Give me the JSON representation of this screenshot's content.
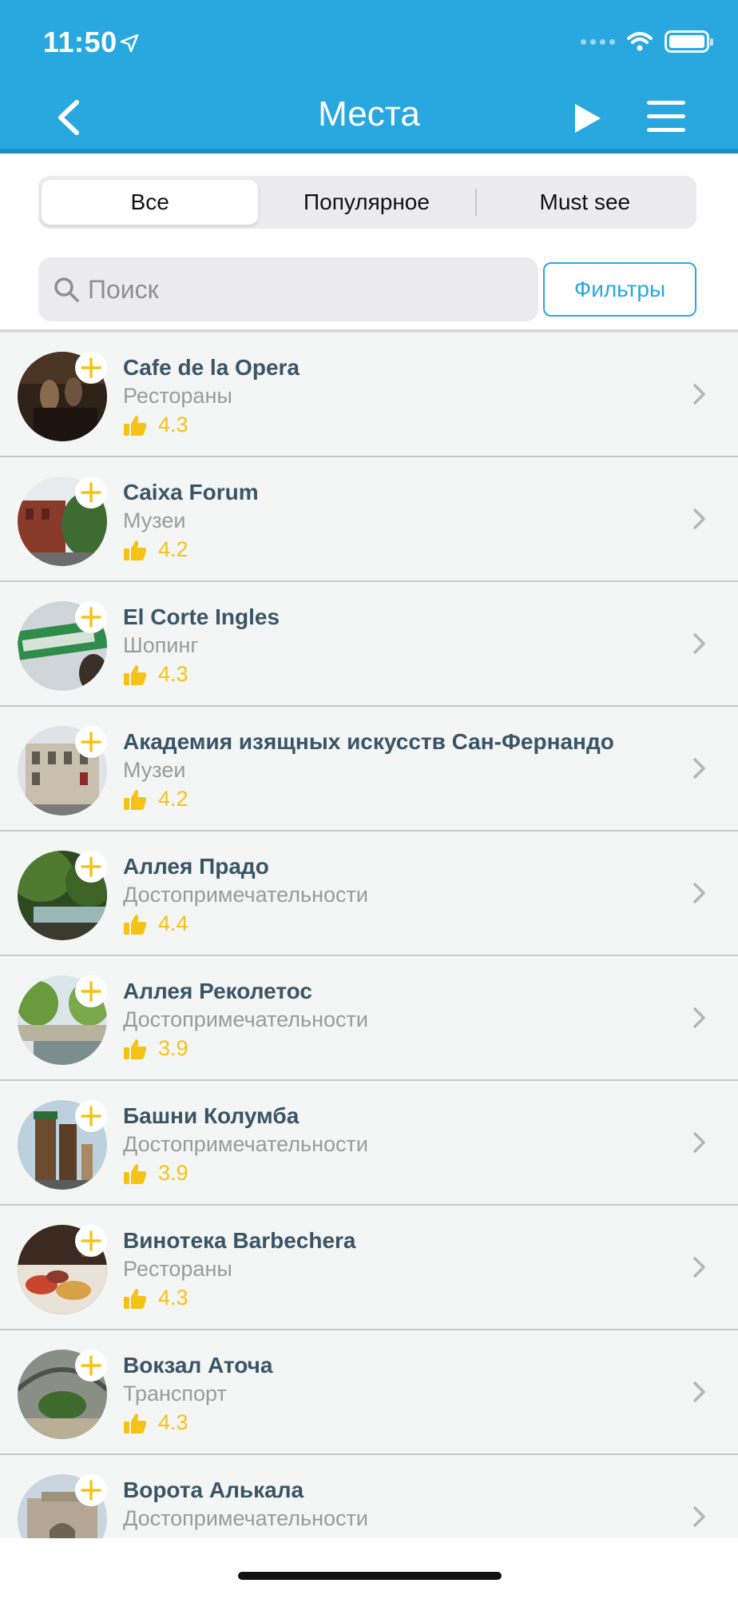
{
  "status_bar": {
    "time": "11:50"
  },
  "nav": {
    "title": "Места"
  },
  "segments": [
    {
      "label": "Все",
      "active": true
    },
    {
      "label": "Популярное",
      "active": false
    },
    {
      "label": "Must see",
      "active": false
    }
  ],
  "search": {
    "placeholder": "Поиск",
    "value": ""
  },
  "filters_label": "Фильтры",
  "colors": {
    "header": "#29a8e0",
    "title": "#3a5566",
    "rating": "#f5c315",
    "category": "#9b9b9b"
  },
  "places": [
    {
      "title": "Cafe de la Opera",
      "category": "Рестораны",
      "rating": "4.3"
    },
    {
      "title": "Caixa Forum",
      "category": "Музеи",
      "rating": "4.2"
    },
    {
      "title": "El Corte Ingles",
      "category": "Шопинг",
      "rating": "4.3"
    },
    {
      "title": "Академия изящных искусств Сан-Фернандо",
      "category": "Музеи",
      "rating": "4.2"
    },
    {
      "title": "Аллея Прадо",
      "category": "Достопримечательности",
      "rating": "4.4"
    },
    {
      "title": "Аллея Реколетос",
      "category": "Достопримечательности",
      "rating": "3.9"
    },
    {
      "title": "Башни Колумба",
      "category": "Достопримечательности",
      "rating": "3.9"
    },
    {
      "title": "Винотека Barbechera",
      "category": "Рестораны",
      "rating": "4.3"
    },
    {
      "title": "Вокзал Аточа",
      "category": "Транспорт",
      "rating": "4.3"
    },
    {
      "title": "Ворота Алькала",
      "category": "Достопримечательности",
      "rating": ""
    }
  ]
}
